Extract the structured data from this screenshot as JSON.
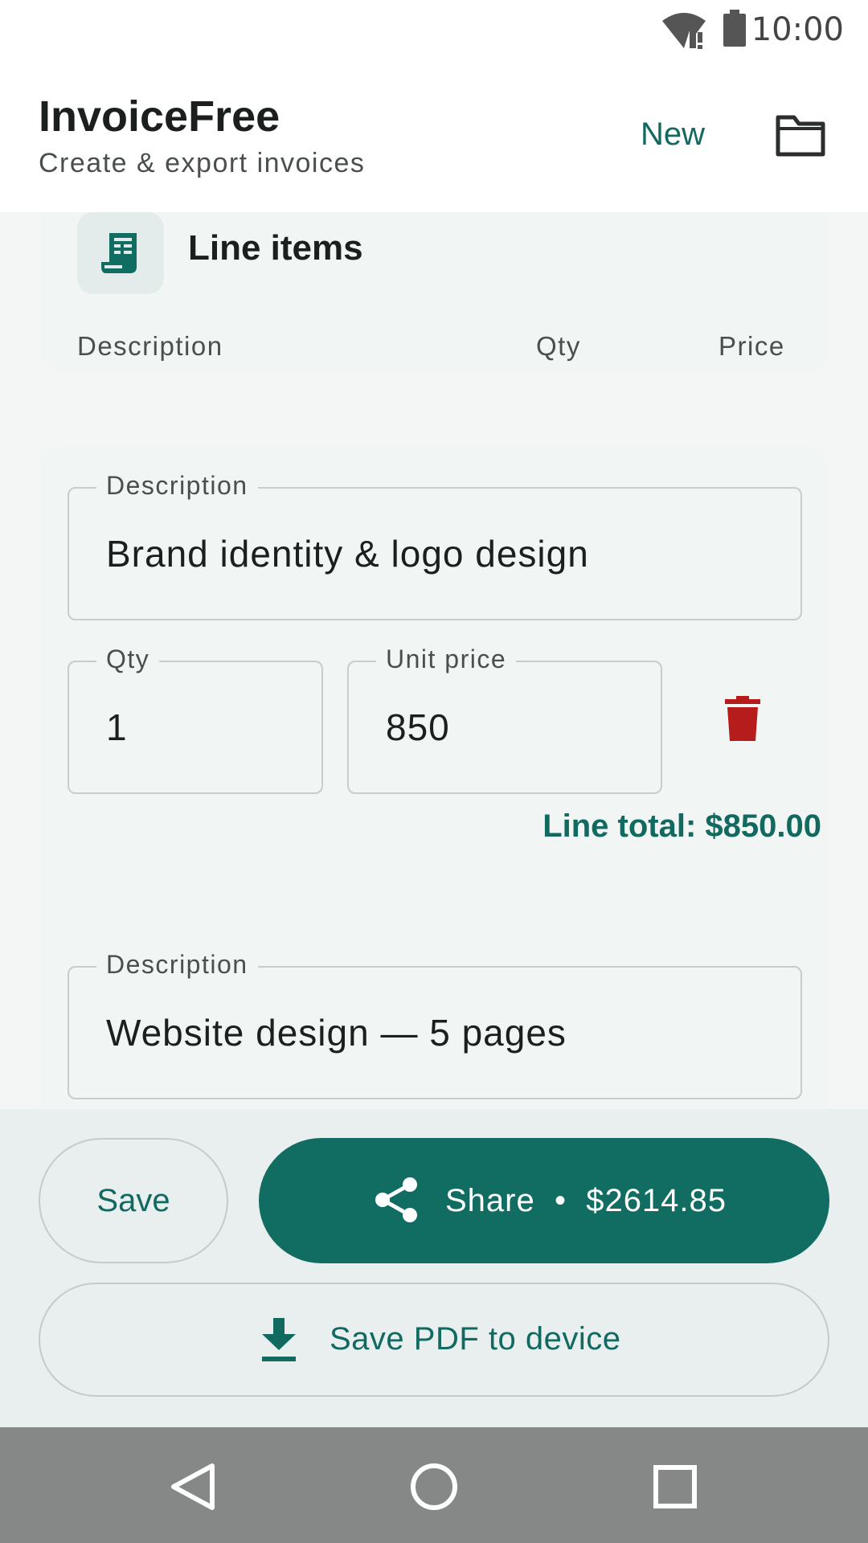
{
  "status_bar": {
    "time": "10:00"
  },
  "app_bar": {
    "title": "InvoiceFree",
    "subtitle": "Create & export invoices",
    "new_label": "New"
  },
  "line_items_section": {
    "title": "Line items",
    "columns": {
      "description": "Description",
      "qty": "Qty",
      "price": "Price"
    }
  },
  "items": [
    {
      "description_label": "Description",
      "description": "Brand identity & logo design",
      "qty_label": "Qty",
      "qty": "1",
      "unit_price_label": "Unit price",
      "unit_price": "850",
      "line_total": "Line total: $850.00"
    },
    {
      "description_label": "Description",
      "description": "Website design — 5 pages"
    }
  ],
  "actions": {
    "save_label": "Save",
    "share_label": "Share  •  $2614.85",
    "save_pdf_label": "Save PDF to device"
  },
  "colors": {
    "accent": "#116d62",
    "delete": "#b71c1c",
    "surface": "#f1f5f4"
  },
  "icons": [
    "wifi-icon",
    "battery-icon",
    "folder-icon",
    "receipt-icon",
    "trash-icon",
    "share-icon",
    "download-icon",
    "back-icon",
    "home-icon",
    "recents-icon"
  ]
}
